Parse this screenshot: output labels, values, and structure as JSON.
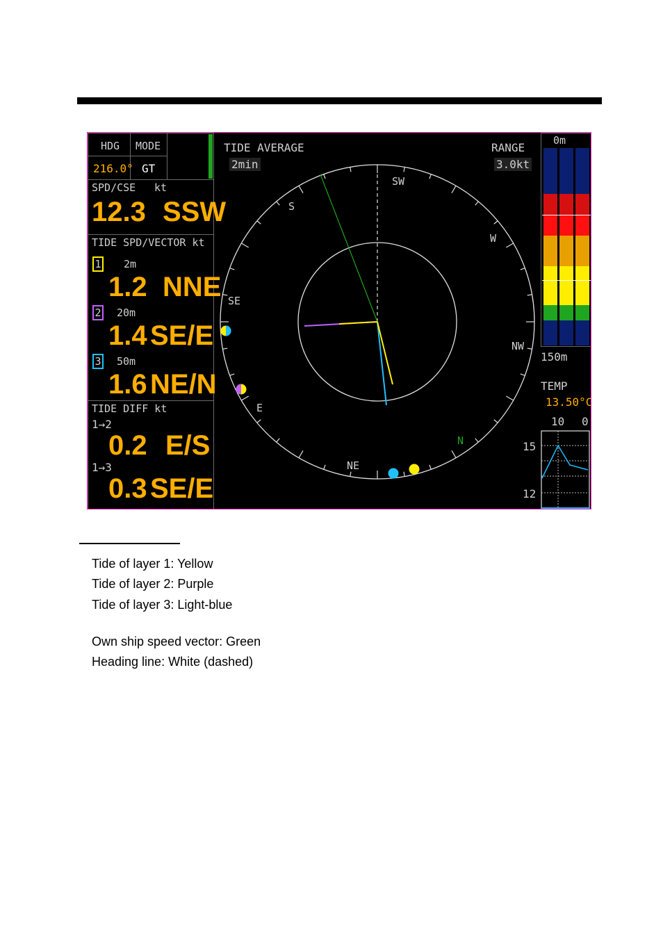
{
  "display": {
    "hdg": {
      "label": "HDG",
      "value": "216.0°"
    },
    "mode": {
      "label": "MODE",
      "value": "GT"
    },
    "spd_cse": {
      "label": "SPD/CSE",
      "unit": "kt",
      "speed": "12.3",
      "course": "SSW"
    },
    "tide_vector": {
      "label": "TIDE SPD/VECTOR kt",
      "layers": [
        {
          "num": "1",
          "depth": "2m",
          "speed": "1.2",
          "dir": "NNE",
          "color": "#ffee00"
        },
        {
          "num": "2",
          "depth": "20m",
          "speed": "1.4",
          "dir": "SE/E",
          "color": "#c060ff"
        },
        {
          "num": "3",
          "depth": "50m",
          "speed": "1.6",
          "dir": "NE/N",
          "color": "#1ec0ff"
        }
      ]
    },
    "tide_diff": {
      "label": "TIDE DIFF kt",
      "rows": [
        {
          "pair": "1→2",
          "speed": "0.2",
          "dir": "E/S"
        },
        {
          "pair": "1→3",
          "speed": "0.3",
          "dir": "SE/E"
        }
      ]
    },
    "tide_average": {
      "label": "TIDE AVERAGE",
      "value": "2min"
    },
    "range": {
      "label": "RANGE",
      "value": "3.0kt"
    },
    "compass_labels": {
      "sw": "SW",
      "s": "S",
      "w": "W",
      "se": "SE",
      "nw": "NW",
      "e": "E",
      "ne": "NE",
      "n": "N"
    },
    "depth_bar": {
      "top": "0m",
      "bottom": "150m"
    },
    "temp": {
      "label": "TEMP",
      "value": "13.50°C",
      "x_left": "10",
      "x_right": "0",
      "y_top": "15",
      "y_bottom": "12"
    }
  },
  "legend": {
    "items": [
      "Tide of layer 1: Yellow",
      "Tide of layer 2: Purple",
      "Tide of layer 3: Light-blue",
      "Own ship speed vector: Green",
      "Heading line: White (dashed)"
    ]
  }
}
